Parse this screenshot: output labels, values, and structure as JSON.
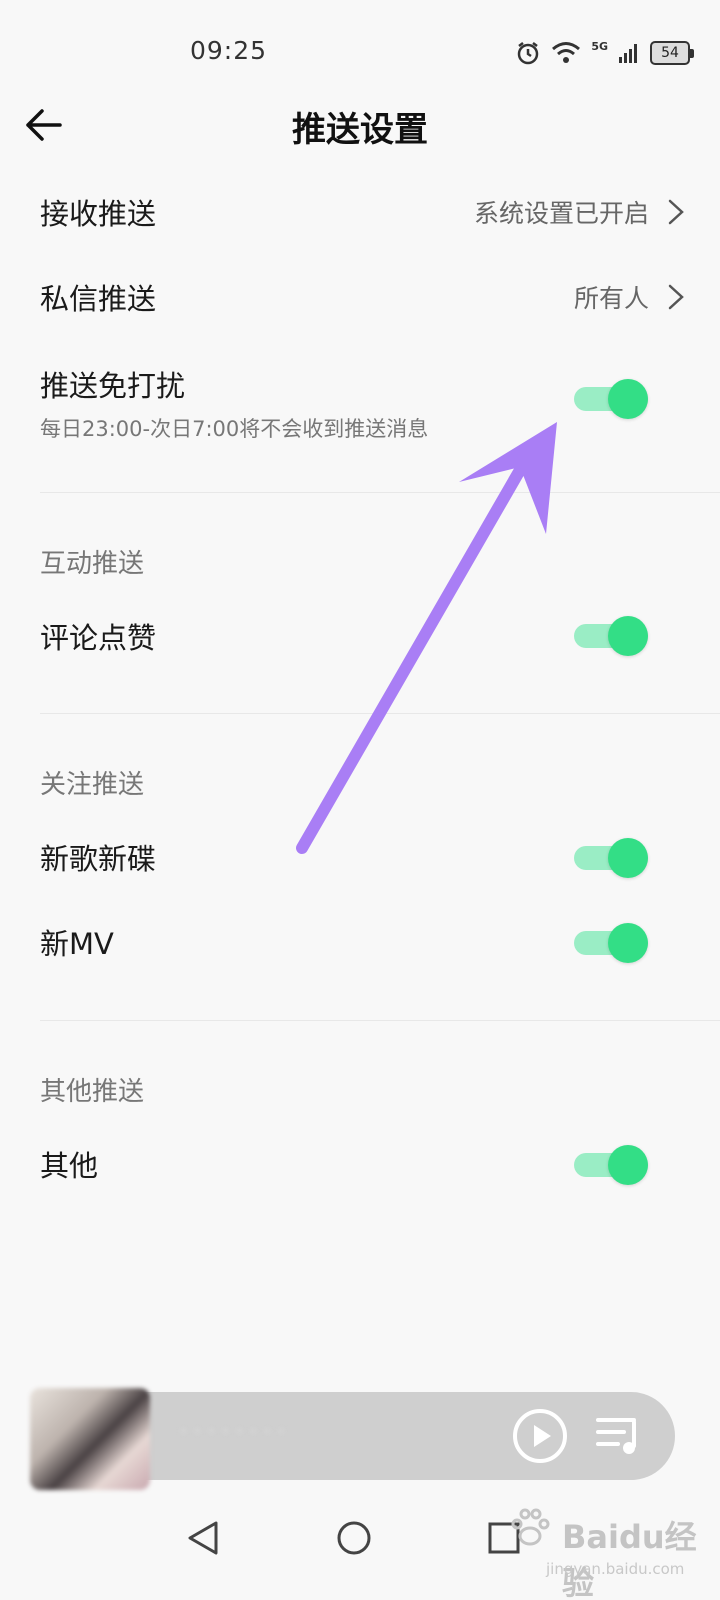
{
  "status_bar": {
    "time": "09:25",
    "network": "5G",
    "battery": "54",
    "icons": [
      "alarm-icon",
      "wifi-icon",
      "signal-icon",
      "battery-icon"
    ]
  },
  "header": {
    "title": "推送设置",
    "back_icon": "arrow-left-icon"
  },
  "settings": {
    "receive_push": {
      "label": "接收推送",
      "value": "系统设置已开启"
    },
    "message_push": {
      "label": "私信推送",
      "value": "所有人"
    },
    "dnd": {
      "label": "推送免打扰",
      "sublabel": "每日23:00-次日7:00将不会收到推送消息",
      "enabled": true
    }
  },
  "sections": {
    "interaction": {
      "header": "互动推送",
      "items": [
        {
          "label": "评论点赞",
          "enabled": true
        }
      ]
    },
    "follow": {
      "header": "关注推送",
      "items": [
        {
          "label": "新歌新碟",
          "enabled": true
        },
        {
          "label": "新MV",
          "enabled": true
        }
      ]
    },
    "other": {
      "header": "其他推送",
      "items": [
        {
          "label": "其他",
          "enabled": true
        }
      ]
    }
  },
  "mini_player": {
    "song_text": "· · · · · · · ·",
    "icons": [
      "play-icon",
      "playlist-icon"
    ]
  },
  "nav_bar": {
    "icons": [
      "back-triangle-icon",
      "home-circle-icon",
      "recents-square-icon"
    ]
  },
  "watermark": {
    "main": "Baidu经验",
    "sub": "jingyan.baidu.com"
  },
  "colors": {
    "toggle_on": "#33de86",
    "toggle_track": "#9aedc5",
    "annotation_arrow": "#a97ef5",
    "background": "#f8f8f8"
  }
}
